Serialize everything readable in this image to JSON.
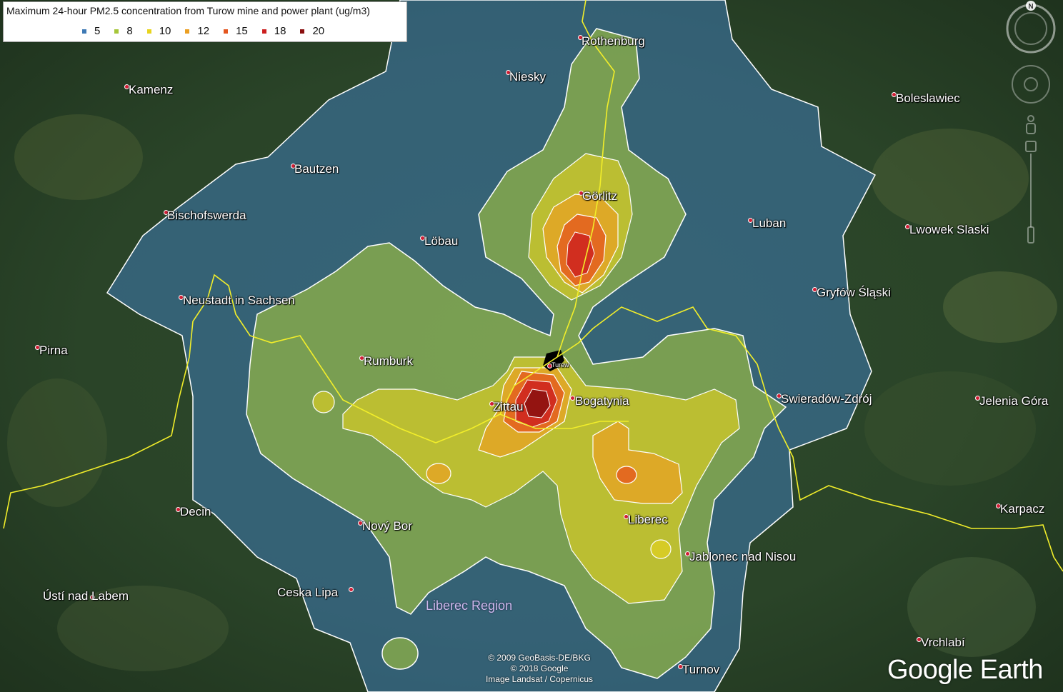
{
  "legend": {
    "title": "Maximum 24-hour PM2.5 concentration from Turow mine and power plant (ug/m3)",
    "items": [
      {
        "label": "5",
        "color": "#3e7ab5"
      },
      {
        "label": "8",
        "color": "#a6c63a"
      },
      {
        "label": "10",
        "color": "#e8d41e"
      },
      {
        "label": "12",
        "color": "#eb9f22"
      },
      {
        "label": "15",
        "color": "#e4561f"
      },
      {
        "label": "18",
        "color": "#cc1f1f"
      },
      {
        "label": "20",
        "color": "#8a0f0f"
      }
    ]
  },
  "places": [
    {
      "name": "Rothenburg"
    },
    {
      "name": "Niesky"
    },
    {
      "name": "Kamenz"
    },
    {
      "name": "Boleslawiec"
    },
    {
      "name": "Bautzen"
    },
    {
      "name": "Görlitz"
    },
    {
      "name": "Bischofswerda"
    },
    {
      "name": "Luban"
    },
    {
      "name": "Lwowek Slaski"
    },
    {
      "name": "Löbau"
    },
    {
      "name": "Gryfów Śląski"
    },
    {
      "name": "Neustadt in Sachsen"
    },
    {
      "name": "Pirna"
    },
    {
      "name": "Rumburk"
    },
    {
      "name": "Turew"
    },
    {
      "name": "Zittau"
    },
    {
      "name": "Bogatynia"
    },
    {
      "name": "Swieradów-Zdrój"
    },
    {
      "name": "Jelenia Góra"
    },
    {
      "name": "Decin"
    },
    {
      "name": "Karpacz"
    },
    {
      "name": "Liberec"
    },
    {
      "name": "Nový Bor"
    },
    {
      "name": "Jablonec nad Nisou"
    },
    {
      "name": "Ústí nad Labem"
    },
    {
      "name": "Ceska Lipa"
    },
    {
      "name": "Vrchlabí"
    },
    {
      "name": "Turnov"
    }
  ],
  "region_label": "Liberec Region",
  "attribution": [
    "© 2009 GeoBasis-DE/BKG",
    "© 2018 Google",
    "Image Landsat / Copernicus"
  ],
  "brand": "Google Earth",
  "compass_letter": "N",
  "colors": {
    "terrain": "#233a22",
    "border_line": "#f2ee2a",
    "contour_line": "#ffffff"
  }
}
